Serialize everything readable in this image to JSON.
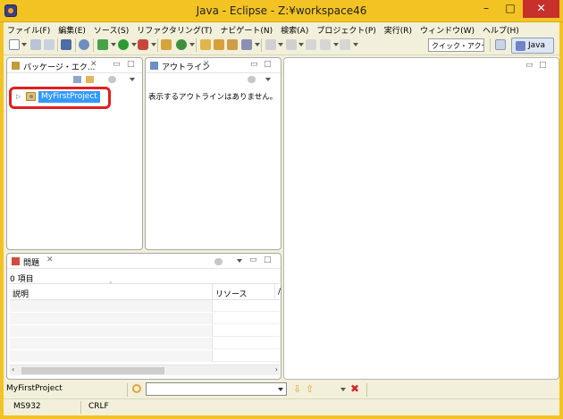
{
  "window": {
    "title": "Java - Eclipse - Z:¥workspace46",
    "min": "–",
    "max": "□",
    "close": "✕"
  },
  "menu": [
    "ファイル(F)",
    "編集(E)",
    "ソース(S)",
    "リファクタリング(T)",
    "ナビゲート(N)",
    "検索(A)",
    "プロジェクト(P)",
    "実行(R)",
    "ウィンドウ(W)",
    "ヘルプ(H)"
  ],
  "toolbar": {
    "quick_access": "クイック・アクセス",
    "perspective": "Java"
  },
  "package_explorer": {
    "tab": "パッケージ・エク...",
    "project": "MyFirstProject"
  },
  "outline": {
    "tab": "アウトライン",
    "message": "表示するアウトラインはありません。"
  },
  "problems": {
    "tab": "問題",
    "count": "0 項目",
    "columns": [
      "説明",
      "リソース",
      "/"
    ]
  },
  "status": {
    "selection": "MyFirstProject",
    "encoding": "MS932",
    "line_ending": "CRLF"
  },
  "colors": {
    "titlebar": "#f2c322",
    "selection": "#3399ff",
    "annotation": "#e02020"
  }
}
